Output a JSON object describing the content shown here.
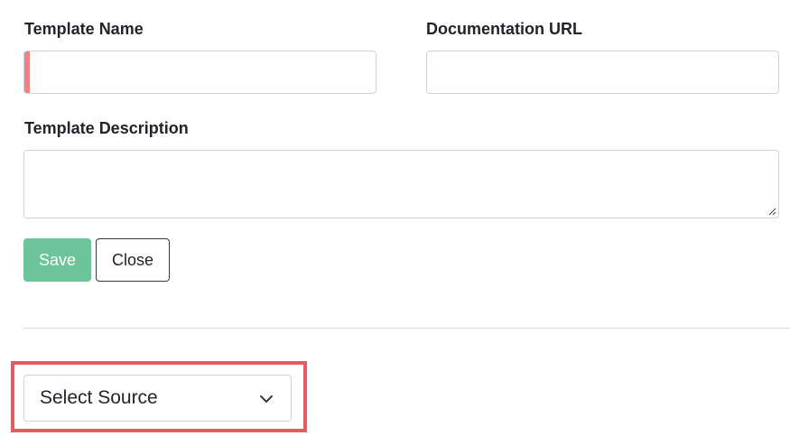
{
  "form": {
    "template_name_label": "Template Name",
    "template_name_value": "",
    "documentation_url_label": "Documentation URL",
    "documentation_url_value": "",
    "template_description_label": "Template Description",
    "template_description_value": "",
    "save_label": "Save",
    "close_label": "Close"
  },
  "source_select": {
    "selected": "Select Source"
  },
  "colors": {
    "save_button": "#6cc49a",
    "invalid_indicator": "#f07f86",
    "highlight_border": "#e05d61"
  },
  "icons": {
    "select_arrow": "chevron-down-icon",
    "textarea_grip": "resize-grip-icon"
  }
}
